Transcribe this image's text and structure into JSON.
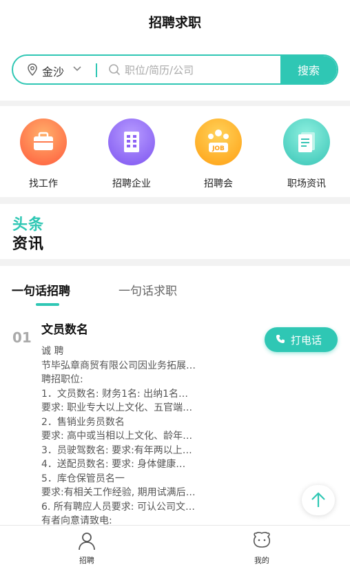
{
  "header": {
    "title": "招聘求职"
  },
  "search": {
    "location": "金沙",
    "placeholder": "职位/简历/公司",
    "button_label": "搜索"
  },
  "quicknav": [
    {
      "label": "找工作",
      "icon": "briefcase-icon"
    },
    {
      "label": "招聘企业",
      "icon": "building-icon"
    },
    {
      "label": "招聘会",
      "icon": "job-fair-icon"
    },
    {
      "label": "职场资讯",
      "icon": "news-icon"
    }
  ],
  "headline": {
    "line1": "头条",
    "line2": "资讯"
  },
  "tabs": {
    "active": "一句话招聘",
    "inactive": "一句话求职"
  },
  "post": {
    "number": "01",
    "title": "文员数名",
    "call_label": "打电话",
    "lines": [
      "诚  聘",
      "节毕弘章商贸有限公司因业务拓展…",
      "聘招职位:",
      "1．文员数名:  财务1名:  出纳1名…",
      "要求:  职业专大以上文化、五官端…",
      "2．售销业务员数名",
      "要求:  高中或当相以上文化、龄年…",
      "3．员驶驾数名:  要求:有年两以上…",
      "4．送配员数名:  要求:  身体健康…",
      "5．库仓保管员名一",
      "要求:有相关工作经验, 期用试满后…",
      "6. 所有聘应人员要求:  可认公司文…",
      "有者向意请致电:"
    ]
  },
  "bottom_nav": [
    {
      "label": "招聘",
      "icon": "user-icon"
    },
    {
      "label": "我的",
      "icon": "profile-face-icon"
    }
  ],
  "colors": {
    "accent": "#2fc7b4"
  }
}
